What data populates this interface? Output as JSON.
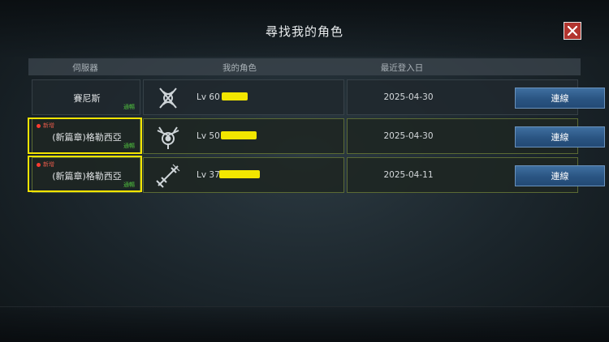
{
  "window": {
    "title": "尋找我的角色"
  },
  "table": {
    "headers": {
      "server": "伺服器",
      "character": "我的角色",
      "last_login": "最近登入日"
    },
    "rows": [
      {
        "server": "賽尼斯",
        "new_tag": "",
        "status": "通暢",
        "level": "Lv 60",
        "last_login": "2025-04-30",
        "connect": "連線",
        "class_icon": "crossed-blades-icon",
        "active": false
      },
      {
        "server": "(新篇章)格勒西亞",
        "new_tag": "新增",
        "status": "通暢",
        "level": "Lv 50",
        "last_login": "2025-04-30",
        "connect": "連線",
        "class_icon": "emblem-icon",
        "active": true
      },
      {
        "server": "(新篇章)格勒西亞",
        "new_tag": "新增",
        "status": "通暢",
        "level": "Lv 37",
        "last_login": "2025-04-11",
        "connect": "連線",
        "class_icon": "sword-icon",
        "active": true
      }
    ]
  },
  "colors": {
    "highlight": "#f4e400",
    "connect_button": "#2a5482",
    "status_green": "#4fbf3f",
    "new_red": "#ff3b30"
  }
}
